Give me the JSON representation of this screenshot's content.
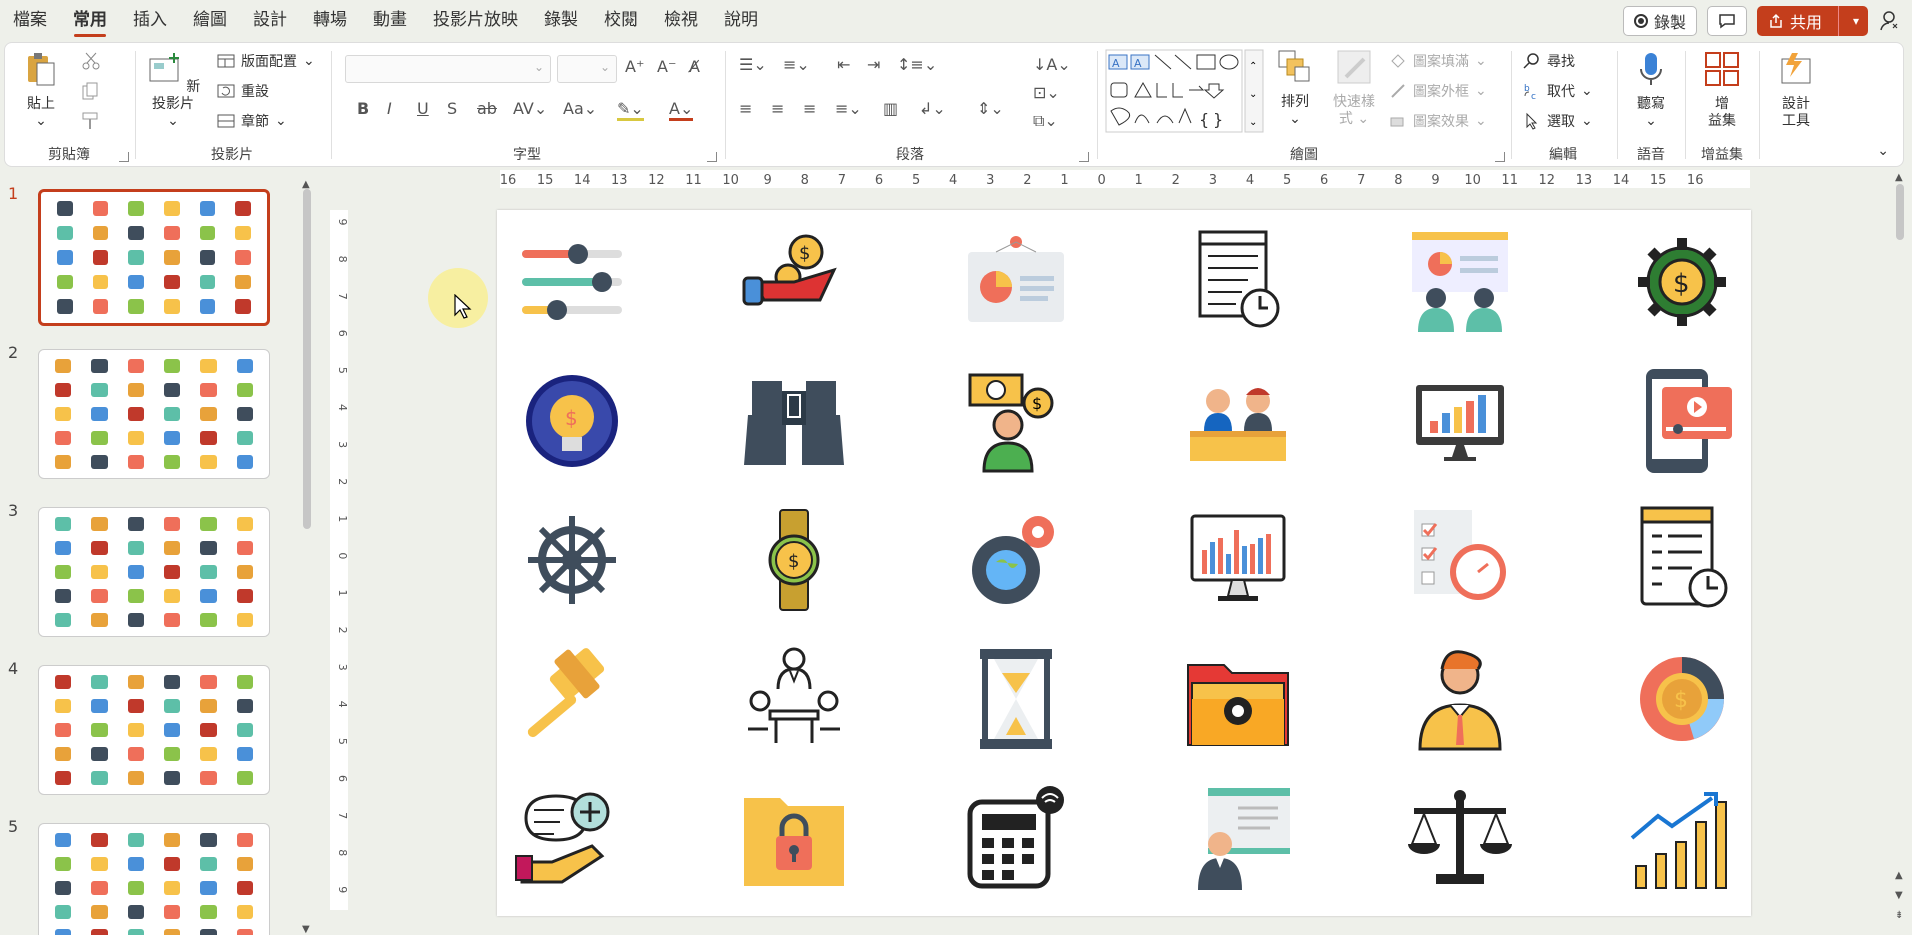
{
  "menu": {
    "tabs": [
      "檔案",
      "常用",
      "插入",
      "繪圖",
      "設計",
      "轉場",
      "動畫",
      "投影片放映",
      "錄製",
      "校閱",
      "檢視",
      "說明"
    ],
    "active": 1
  },
  "header": {
    "record_label": "錄製",
    "share_label": "共用"
  },
  "ribbon": {
    "clipboard": {
      "label": "剪貼簿",
      "paste": "貼上"
    },
    "slides": {
      "label": "投影片",
      "new_slide_line1": "新",
      "new_slide_line2": "投影片",
      "layout": "版面配置",
      "reset": "重設",
      "section": "章節"
    },
    "font": {
      "label": "字型"
    },
    "paragraph": {
      "label": "段落"
    },
    "drawing": {
      "label": "繪圖",
      "arrange": "排列",
      "quick_styles_line1": "快速樣",
      "quick_styles_line2": "式",
      "shape_fill": "圖案填滿",
      "shape_outline": "圖案外框",
      "shape_effects": "圖案效果"
    },
    "editing": {
      "label": "編輯",
      "find": "尋找",
      "replace": "取代",
      "select": "選取"
    },
    "voice": {
      "label": "語音",
      "dictate": "聽寫"
    },
    "addins": {
      "label": "增益集",
      "addins_line1": "增",
      "addins_line2": "益集"
    },
    "designer": {
      "line1": "設計",
      "line2": "工具"
    }
  },
  "slides": [
    {
      "number": "1"
    },
    {
      "number": "2"
    },
    {
      "number": "3"
    },
    {
      "number": "4"
    },
    {
      "number": "5"
    }
  ],
  "selected_slide": 1,
  "ruler": {
    "h_ticks": [
      "16",
      "15",
      "14",
      "13",
      "12",
      "11",
      "10",
      "9",
      "8",
      "7",
      "6",
      "5",
      "4",
      "3",
      "2",
      "1",
      "0",
      "1",
      "2",
      "3",
      "4",
      "5",
      "6",
      "7",
      "8",
      "9",
      "10",
      "11",
      "12",
      "13",
      "14",
      "15",
      "16"
    ],
    "v_ticks": [
      "9",
      "8",
      "7",
      "6",
      "5",
      "4",
      "3",
      "2",
      "1",
      "0",
      "1",
      "2",
      "3",
      "4",
      "5",
      "6",
      "7",
      "8",
      "9"
    ]
  },
  "icons": [
    "sliders-icon",
    "hand-coin-icon",
    "presentation-board-icon",
    "schedule-list-clock-icon",
    "meeting-presentation-icon",
    "gear-dollar-icon",
    "lightbulb-dollar-icon",
    "binoculars-icon",
    "money-businessman-icon",
    "meeting-desk-icon",
    "monitor-chart-icon",
    "tablet-video-icon",
    "ship-wheel-icon",
    "watch-dollar-icon",
    "gears-globe-icon",
    "monitor-bar-chart-icon",
    "checklist-clock-icon",
    "document-clock-icon",
    "gavel-icon",
    "team-meeting-icon",
    "hourglass-icon",
    "folder-gear-icon",
    "businessman-icon",
    "donut-dollar-icon",
    "idea-hand-icon",
    "folder-lock-icon",
    "calculator-wifi-icon",
    "presenter-board-icon",
    "balance-scale-icon",
    "growth-chart-icon"
  ],
  "colors": {
    "accent": "#c43e1c",
    "dark": "#3f4d5c",
    "yellow": "#f7c24a",
    "teal": "#5dbfa8",
    "coral": "#ef6f5a"
  }
}
